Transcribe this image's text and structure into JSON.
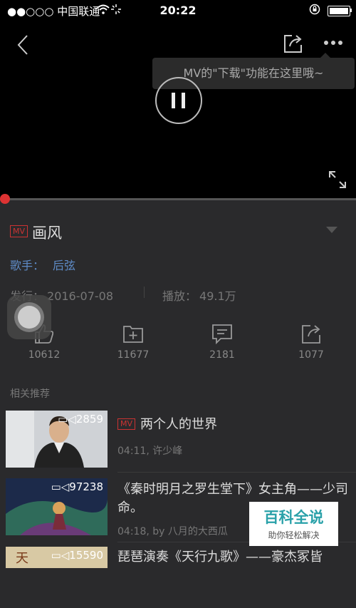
{
  "status_bar": {
    "carrier": "●●○○○ 中国联通",
    "time": "20:22"
  },
  "player": {
    "tooltip": "MV的\"下载\"功能在这里哦~",
    "progress": 0.0
  },
  "song": {
    "badge": "MV",
    "title": "画风",
    "singer_label": "歌手：",
    "singer": "后弦",
    "release_label": "发行：",
    "release_date": "2016-07-08",
    "plays_label": "播放：",
    "plays": "49.1万"
  },
  "actions": [
    {
      "icon": "thumbs-up-icon",
      "count": "10612"
    },
    {
      "icon": "add-to-folder-icon",
      "count": "11677"
    },
    {
      "icon": "comment-icon",
      "count": "2181"
    },
    {
      "icon": "share-icon",
      "count": "1077"
    }
  ],
  "related": {
    "heading": "相关推荐",
    "items": [
      {
        "badge": "MV",
        "title": "两个人的世界",
        "meta": "04:11, 许少峰",
        "views": "2859"
      },
      {
        "title": "《秦时明月之罗生堂下》女主角——少司命。",
        "meta": "04:18, by 八月的大西瓜",
        "views": "97238"
      },
      {
        "title": "琵琶演奏《天行九歌》——豪杰冢皆",
        "views": "15590"
      }
    ]
  },
  "watermark": {
    "title": "百科全说",
    "subtitle": "助你轻松解决"
  },
  "colors": {
    "accent_red": "#d33",
    "link_blue": "#5e8bc6",
    "background": "#2a2a2c"
  }
}
